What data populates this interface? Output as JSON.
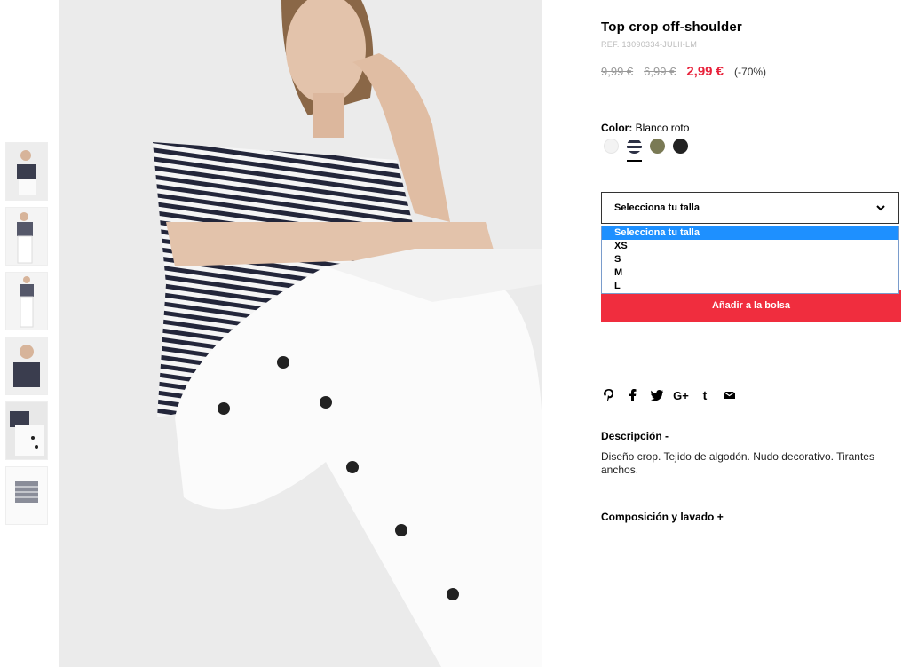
{
  "product": {
    "title": "Top crop off-shoulder",
    "ref": "REF. 13090334-JULII-LM",
    "price_original": "9,99 €",
    "price_previous": "6,99 €",
    "price_current": "2,99 €",
    "discount": "(-70%)"
  },
  "color": {
    "label": "Color:",
    "value": "Blanco roto",
    "swatches": [
      {
        "name": "white",
        "hex": "#f3f3f3"
      },
      {
        "name": "navy-stripe",
        "hex": "#2d3145"
      },
      {
        "name": "khaki",
        "hex": "#7a7a55"
      },
      {
        "name": "black",
        "hex": "#222222"
      }
    ]
  },
  "size": {
    "placeholder": "Selecciona tu talla",
    "options": [
      "Selecciona tu talla",
      "XS",
      "S",
      "M",
      "L"
    ]
  },
  "add_to_bag": "Añadir a la bolsa",
  "social": [
    "pinterest-icon",
    "facebook-icon",
    "twitter-icon",
    "google-plus-icon",
    "tumblr-icon",
    "email-icon"
  ],
  "description": {
    "heading": "Descripción -",
    "text": "Diseño crop. Tejido de algodón. Nudo decorativo. Tirantes anchos."
  },
  "composition": {
    "heading": "Composición y lavado +"
  },
  "colors": {
    "accent": "#f02d3e",
    "price_red": "#e8213a",
    "highlight": "#1e90ff"
  }
}
